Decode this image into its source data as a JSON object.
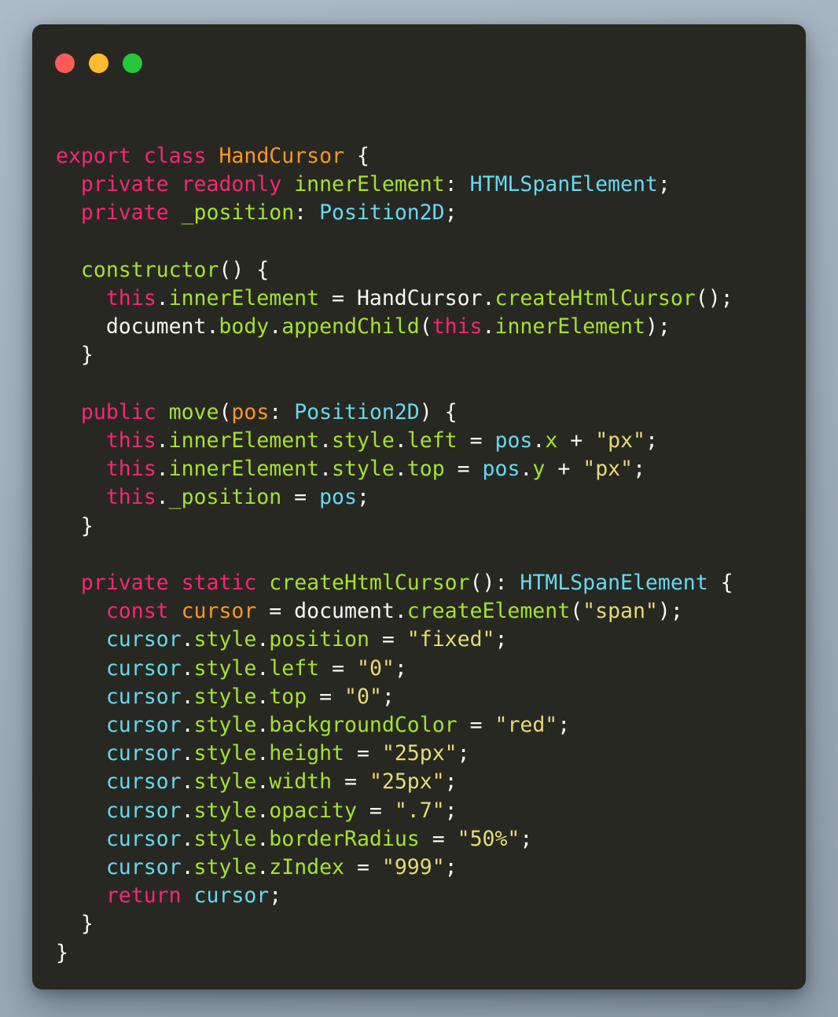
{
  "window": {
    "background_color": "#272822",
    "outer_background_color": "#a6b4c2",
    "traffic_lights": [
      {
        "name": "close",
        "color": "#fc5c58"
      },
      {
        "name": "minimize",
        "color": "#febc2e"
      },
      {
        "name": "maximize",
        "color": "#28c63a"
      }
    ]
  },
  "theme": {
    "keyword": "#f92672",
    "type": "#66d9ef",
    "function": "#a6e22e",
    "parameter": "#fd971f",
    "string": "#e6db74",
    "plain": "#f8f8f2"
  },
  "code": {
    "language": "typescript",
    "lines": [
      "export class HandCursor {",
      "  private readonly innerElement: HTMLSpanElement;",
      "  private _position: Position2D;",
      "",
      "  constructor() {",
      "    this.innerElement = HandCursor.createHtmlCursor();",
      "    document.body.appendChild(this.innerElement);",
      "  }",
      "",
      "  public move(pos: Position2D) {",
      "    this.innerElement.style.left = pos.x + \"px\";",
      "    this.innerElement.style.top = pos.y + \"px\";",
      "    this._position = pos;",
      "  }",
      "",
      "  private static createHtmlCursor(): HTMLSpanElement {",
      "    const cursor = document.createElement(\"span\");",
      "    cursor.style.position = \"fixed\";",
      "    cursor.style.left = \"0\";",
      "    cursor.style.top = \"0\";",
      "    cursor.style.backgroundColor = \"red\";",
      "    cursor.style.height = \"25px\";",
      "    cursor.style.width = \"25px\";",
      "    cursor.style.opacity = \".7\";",
      "    cursor.style.borderRadius = \"50%\";",
      "    cursor.style.zIndex = \"999\";",
      "    return cursor;",
      "  }",
      "}"
    ],
    "tokens": [
      [
        {
          "t": "export",
          "c": "t-keyword"
        },
        {
          "t": " ",
          "c": "t-plain"
        },
        {
          "t": "class",
          "c": "t-keyword"
        },
        {
          "t": " ",
          "c": "t-plain"
        },
        {
          "t": "HandCursor",
          "c": "t-classname"
        },
        {
          "t": " {",
          "c": "t-plain"
        }
      ],
      [
        {
          "t": "  ",
          "c": "t-plain"
        },
        {
          "t": "private",
          "c": "t-keyword"
        },
        {
          "t": " ",
          "c": "t-plain"
        },
        {
          "t": "readonly",
          "c": "t-keyword"
        },
        {
          "t": " ",
          "c": "t-plain"
        },
        {
          "t": "innerElement",
          "c": "t-prop"
        },
        {
          "t": ": ",
          "c": "t-plain"
        },
        {
          "t": "HTMLSpanElement",
          "c": "t-type"
        },
        {
          "t": ";",
          "c": "t-plain"
        }
      ],
      [
        {
          "t": "  ",
          "c": "t-plain"
        },
        {
          "t": "private",
          "c": "t-keyword"
        },
        {
          "t": " ",
          "c": "t-plain"
        },
        {
          "t": "_position",
          "c": "t-prop"
        },
        {
          "t": ": ",
          "c": "t-plain"
        },
        {
          "t": "Position2D",
          "c": "t-type"
        },
        {
          "t": ";",
          "c": "t-plain"
        }
      ],
      [],
      [
        {
          "t": "  ",
          "c": "t-plain"
        },
        {
          "t": "constructor",
          "c": "t-func"
        },
        {
          "t": "() {",
          "c": "t-plain"
        }
      ],
      [
        {
          "t": "    ",
          "c": "t-plain"
        },
        {
          "t": "this",
          "c": "t-keyword"
        },
        {
          "t": ".",
          "c": "t-plain"
        },
        {
          "t": "innerElement",
          "c": "t-prop"
        },
        {
          "t": " = HandCursor.",
          "c": "t-plain"
        },
        {
          "t": "createHtmlCursor",
          "c": "t-func"
        },
        {
          "t": "();",
          "c": "t-plain"
        }
      ],
      [
        {
          "t": "    document.",
          "c": "t-plain"
        },
        {
          "t": "body",
          "c": "t-prop"
        },
        {
          "t": ".",
          "c": "t-plain"
        },
        {
          "t": "appendChild",
          "c": "t-func"
        },
        {
          "t": "(",
          "c": "t-plain"
        },
        {
          "t": "this",
          "c": "t-keyword"
        },
        {
          "t": ".",
          "c": "t-plain"
        },
        {
          "t": "innerElement",
          "c": "t-prop"
        },
        {
          "t": ");",
          "c": "t-plain"
        }
      ],
      [
        {
          "t": "  }",
          "c": "t-plain"
        }
      ],
      [],
      [
        {
          "t": "  ",
          "c": "t-plain"
        },
        {
          "t": "public",
          "c": "t-keyword"
        },
        {
          "t": " ",
          "c": "t-plain"
        },
        {
          "t": "move",
          "c": "t-func"
        },
        {
          "t": "(",
          "c": "t-plain"
        },
        {
          "t": "pos",
          "c": "t-param"
        },
        {
          "t": ": ",
          "c": "t-plain"
        },
        {
          "t": "Position2D",
          "c": "t-type"
        },
        {
          "t": ") {",
          "c": "t-plain"
        }
      ],
      [
        {
          "t": "    ",
          "c": "t-plain"
        },
        {
          "t": "this",
          "c": "t-keyword"
        },
        {
          "t": ".",
          "c": "t-plain"
        },
        {
          "t": "innerElement",
          "c": "t-prop"
        },
        {
          "t": ".",
          "c": "t-plain"
        },
        {
          "t": "style",
          "c": "t-prop"
        },
        {
          "t": ".",
          "c": "t-plain"
        },
        {
          "t": "left",
          "c": "t-prop"
        },
        {
          "t": " = ",
          "c": "t-plain"
        },
        {
          "t": "pos",
          "c": "t-paramref"
        },
        {
          "t": ".",
          "c": "t-plain"
        },
        {
          "t": "x",
          "c": "t-prop"
        },
        {
          "t": " + ",
          "c": "t-plain"
        },
        {
          "t": "\"px\"",
          "c": "t-string"
        },
        {
          "t": ";",
          "c": "t-plain"
        }
      ],
      [
        {
          "t": "    ",
          "c": "t-plain"
        },
        {
          "t": "this",
          "c": "t-keyword"
        },
        {
          "t": ".",
          "c": "t-plain"
        },
        {
          "t": "innerElement",
          "c": "t-prop"
        },
        {
          "t": ".",
          "c": "t-plain"
        },
        {
          "t": "style",
          "c": "t-prop"
        },
        {
          "t": ".",
          "c": "t-plain"
        },
        {
          "t": "top",
          "c": "t-prop"
        },
        {
          "t": " = ",
          "c": "t-plain"
        },
        {
          "t": "pos",
          "c": "t-paramref"
        },
        {
          "t": ".",
          "c": "t-plain"
        },
        {
          "t": "y",
          "c": "t-prop"
        },
        {
          "t": " + ",
          "c": "t-plain"
        },
        {
          "t": "\"px\"",
          "c": "t-string"
        },
        {
          "t": ";",
          "c": "t-plain"
        }
      ],
      [
        {
          "t": "    ",
          "c": "t-plain"
        },
        {
          "t": "this",
          "c": "t-keyword"
        },
        {
          "t": ".",
          "c": "t-plain"
        },
        {
          "t": "_position",
          "c": "t-prop"
        },
        {
          "t": " = ",
          "c": "t-plain"
        },
        {
          "t": "pos",
          "c": "t-paramref"
        },
        {
          "t": ";",
          "c": "t-plain"
        }
      ],
      [
        {
          "t": "  }",
          "c": "t-plain"
        }
      ],
      [],
      [
        {
          "t": "  ",
          "c": "t-plain"
        },
        {
          "t": "private",
          "c": "t-keyword"
        },
        {
          "t": " ",
          "c": "t-plain"
        },
        {
          "t": "static",
          "c": "t-keyword"
        },
        {
          "t": " ",
          "c": "t-plain"
        },
        {
          "t": "createHtmlCursor",
          "c": "t-func"
        },
        {
          "t": "(): ",
          "c": "t-plain"
        },
        {
          "t": "HTMLSpanElement",
          "c": "t-type"
        },
        {
          "t": " {",
          "c": "t-plain"
        }
      ],
      [
        {
          "t": "    ",
          "c": "t-plain"
        },
        {
          "t": "const",
          "c": "t-keyword"
        },
        {
          "t": " ",
          "c": "t-plain"
        },
        {
          "t": "cursor",
          "c": "t-param"
        },
        {
          "t": " = document.",
          "c": "t-plain"
        },
        {
          "t": "createElement",
          "c": "t-func"
        },
        {
          "t": "(",
          "c": "t-plain"
        },
        {
          "t": "\"span\"",
          "c": "t-string"
        },
        {
          "t": ");",
          "c": "t-plain"
        }
      ],
      [
        {
          "t": "    ",
          "c": "t-plain"
        },
        {
          "t": "cursor",
          "c": "t-paramref"
        },
        {
          "t": ".",
          "c": "t-plain"
        },
        {
          "t": "style",
          "c": "t-prop"
        },
        {
          "t": ".",
          "c": "t-plain"
        },
        {
          "t": "position",
          "c": "t-prop"
        },
        {
          "t": " = ",
          "c": "t-plain"
        },
        {
          "t": "\"fixed\"",
          "c": "t-string"
        },
        {
          "t": ";",
          "c": "t-plain"
        }
      ],
      [
        {
          "t": "    ",
          "c": "t-plain"
        },
        {
          "t": "cursor",
          "c": "t-paramref"
        },
        {
          "t": ".",
          "c": "t-plain"
        },
        {
          "t": "style",
          "c": "t-prop"
        },
        {
          "t": ".",
          "c": "t-plain"
        },
        {
          "t": "left",
          "c": "t-prop"
        },
        {
          "t": " = ",
          "c": "t-plain"
        },
        {
          "t": "\"0\"",
          "c": "t-string"
        },
        {
          "t": ";",
          "c": "t-plain"
        }
      ],
      [
        {
          "t": "    ",
          "c": "t-plain"
        },
        {
          "t": "cursor",
          "c": "t-paramref"
        },
        {
          "t": ".",
          "c": "t-plain"
        },
        {
          "t": "style",
          "c": "t-prop"
        },
        {
          "t": ".",
          "c": "t-plain"
        },
        {
          "t": "top",
          "c": "t-prop"
        },
        {
          "t": " = ",
          "c": "t-plain"
        },
        {
          "t": "\"0\"",
          "c": "t-string"
        },
        {
          "t": ";",
          "c": "t-plain"
        }
      ],
      [
        {
          "t": "    ",
          "c": "t-plain"
        },
        {
          "t": "cursor",
          "c": "t-paramref"
        },
        {
          "t": ".",
          "c": "t-plain"
        },
        {
          "t": "style",
          "c": "t-prop"
        },
        {
          "t": ".",
          "c": "t-plain"
        },
        {
          "t": "backgroundColor",
          "c": "t-prop"
        },
        {
          "t": " = ",
          "c": "t-plain"
        },
        {
          "t": "\"red\"",
          "c": "t-string"
        },
        {
          "t": ";",
          "c": "t-plain"
        }
      ],
      [
        {
          "t": "    ",
          "c": "t-plain"
        },
        {
          "t": "cursor",
          "c": "t-paramref"
        },
        {
          "t": ".",
          "c": "t-plain"
        },
        {
          "t": "style",
          "c": "t-prop"
        },
        {
          "t": ".",
          "c": "t-plain"
        },
        {
          "t": "height",
          "c": "t-prop"
        },
        {
          "t": " = ",
          "c": "t-plain"
        },
        {
          "t": "\"25px\"",
          "c": "t-string"
        },
        {
          "t": ";",
          "c": "t-plain"
        }
      ],
      [
        {
          "t": "    ",
          "c": "t-plain"
        },
        {
          "t": "cursor",
          "c": "t-paramref"
        },
        {
          "t": ".",
          "c": "t-plain"
        },
        {
          "t": "style",
          "c": "t-prop"
        },
        {
          "t": ".",
          "c": "t-plain"
        },
        {
          "t": "width",
          "c": "t-prop"
        },
        {
          "t": " = ",
          "c": "t-plain"
        },
        {
          "t": "\"25px\"",
          "c": "t-string"
        },
        {
          "t": ";",
          "c": "t-plain"
        }
      ],
      [
        {
          "t": "    ",
          "c": "t-plain"
        },
        {
          "t": "cursor",
          "c": "t-paramref"
        },
        {
          "t": ".",
          "c": "t-plain"
        },
        {
          "t": "style",
          "c": "t-prop"
        },
        {
          "t": ".",
          "c": "t-plain"
        },
        {
          "t": "opacity",
          "c": "t-prop"
        },
        {
          "t": " = ",
          "c": "t-plain"
        },
        {
          "t": "\".7\"",
          "c": "t-string"
        },
        {
          "t": ";",
          "c": "t-plain"
        }
      ],
      [
        {
          "t": "    ",
          "c": "t-plain"
        },
        {
          "t": "cursor",
          "c": "t-paramref"
        },
        {
          "t": ".",
          "c": "t-plain"
        },
        {
          "t": "style",
          "c": "t-prop"
        },
        {
          "t": ".",
          "c": "t-plain"
        },
        {
          "t": "borderRadius",
          "c": "t-prop"
        },
        {
          "t": " = ",
          "c": "t-plain"
        },
        {
          "t": "\"50%\"",
          "c": "t-string"
        },
        {
          "t": ";",
          "c": "t-plain"
        }
      ],
      [
        {
          "t": "    ",
          "c": "t-plain"
        },
        {
          "t": "cursor",
          "c": "t-paramref"
        },
        {
          "t": ".",
          "c": "t-plain"
        },
        {
          "t": "style",
          "c": "t-prop"
        },
        {
          "t": ".",
          "c": "t-plain"
        },
        {
          "t": "zIndex",
          "c": "t-prop"
        },
        {
          "t": " = ",
          "c": "t-plain"
        },
        {
          "t": "\"999\"",
          "c": "t-string"
        },
        {
          "t": ";",
          "c": "t-plain"
        }
      ],
      [
        {
          "t": "    ",
          "c": "t-plain"
        },
        {
          "t": "return",
          "c": "t-keyword"
        },
        {
          "t": " ",
          "c": "t-plain"
        },
        {
          "t": "cursor",
          "c": "t-paramref"
        },
        {
          "t": ";",
          "c": "t-plain"
        }
      ],
      [
        {
          "t": "  }",
          "c": "t-plain"
        }
      ],
      [
        {
          "t": "}",
          "c": "t-plain"
        }
      ]
    ]
  }
}
